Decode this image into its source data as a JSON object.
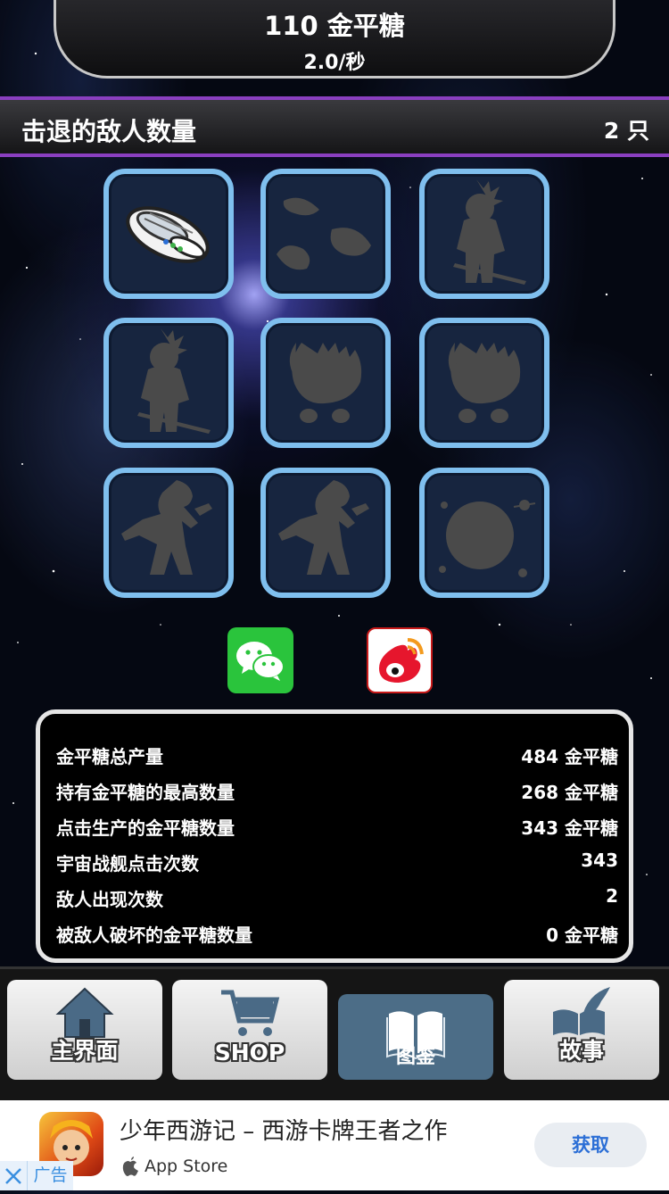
{
  "header": {
    "candy_count": "110 金平糖",
    "candy_rate": "2.0/秒"
  },
  "enemy_bar": {
    "label": "击退的敌人数量",
    "value": "2 只"
  },
  "bestiary": [
    {
      "name": "enemy-spaceship-icon",
      "unlocked": true
    },
    {
      "name": "enemy-meteor-pair-icon",
      "unlocked": false
    },
    {
      "name": "enemy-warrior-silhouette-icon",
      "unlocked": false
    },
    {
      "name": "enemy-warrior-silhouette-icon",
      "unlocked": false
    },
    {
      "name": "enemy-monster-silhouette-icon",
      "unlocked": false
    },
    {
      "name": "enemy-monster-silhouette-icon",
      "unlocked": false
    },
    {
      "name": "enemy-giant-silhouette-icon",
      "unlocked": false
    },
    {
      "name": "enemy-giant-silhouette-icon",
      "unlocked": false
    },
    {
      "name": "enemy-planet-silhouette-icon",
      "unlocked": false
    }
  ],
  "share": {
    "wechat_icon": "wechat-icon",
    "weibo_icon": "weibo-icon",
    "wechat_color": "#2ac43c",
    "weibo_color": "#e6162d"
  },
  "stats": [
    {
      "label": "金平糖总产量",
      "value": "484 金平糖"
    },
    {
      "label": "持有金平糖的最高数量",
      "value": "268 金平糖"
    },
    {
      "label": "点击生产的金平糖数量",
      "value": "343 金平糖"
    },
    {
      "label": "宇宙战舰点击次数",
      "value": "343"
    },
    {
      "label": "敌人出现次数",
      "value": "2"
    },
    {
      "label": "被敌人破坏的金平糖数量",
      "value": "0 金平糖"
    }
  ],
  "nav": {
    "home": "主界面",
    "shop": "SHOP",
    "book": "图鉴",
    "story": "故事",
    "active": "book",
    "active_color": "#4c6d87"
  },
  "ad": {
    "title": "少年西游记 – 西游卡牌王者之作",
    "store": "App Store",
    "button": "获取",
    "tag": "广告"
  },
  "colors": {
    "accent_purple": "#8a3fc0",
    "tile_border": "#7fbfee"
  }
}
